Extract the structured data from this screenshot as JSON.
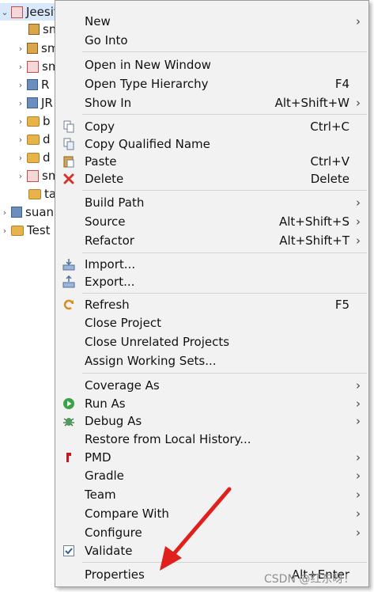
{
  "tree": {
    "items": [
      {
        "name": "Jeesite",
        "expanded": true,
        "selected": true,
        "icon": "project-icon"
      },
      {
        "name": "sm",
        "icon": "package-icon"
      },
      {
        "name": "sm",
        "icon": "package-icon"
      },
      {
        "name": "sm",
        "icon": "package-icon"
      },
      {
        "name": "R",
        "icon": "library-icon"
      },
      {
        "name": "JR",
        "icon": "library-icon"
      },
      {
        "name": "b",
        "icon": "folder-icon"
      },
      {
        "name": "d",
        "icon": "folder-icon"
      },
      {
        "name": "d",
        "icon": "folder-icon"
      },
      {
        "name": "sm",
        "icon": "package-icon"
      },
      {
        "name": "ta",
        "icon": "folder-icon"
      },
      {
        "name": "suan",
        "icon": "project-icon"
      },
      {
        "name": "Test",
        "icon": "project-icon"
      }
    ]
  },
  "menu": {
    "items": [
      {
        "label": "New",
        "submenu": true
      },
      {
        "label": "Go Into"
      },
      {
        "label": "Open in New Window"
      },
      {
        "label": "Open Type Hierarchy",
        "accel": "F4"
      },
      {
        "label": "Show In",
        "accel": "Alt+Shift+W",
        "submenu": true
      },
      {
        "label": "Copy",
        "accel": "Ctrl+C",
        "icon": "copy-icon"
      },
      {
        "label": "Copy Qualified Name",
        "icon": "copy-qualified-name-icon"
      },
      {
        "label": "Paste",
        "accel": "Ctrl+V",
        "icon": "paste-icon"
      },
      {
        "label": "Delete",
        "accel": "Delete",
        "icon": "delete-icon"
      },
      {
        "label": "Build Path",
        "submenu": true
      },
      {
        "label": "Source",
        "accel": "Alt+Shift+S",
        "submenu": true
      },
      {
        "label": "Refactor",
        "accel": "Alt+Shift+T",
        "submenu": true
      },
      {
        "label": "Import...",
        "icon": "import-icon"
      },
      {
        "label": "Export...",
        "icon": "export-icon"
      },
      {
        "label": "Refresh",
        "accel": "F5",
        "icon": "refresh-icon"
      },
      {
        "label": "Close Project"
      },
      {
        "label": "Close Unrelated Projects"
      },
      {
        "label": "Assign Working Sets..."
      },
      {
        "label": "Coverage As",
        "submenu": true
      },
      {
        "label": "Run As",
        "submenu": true,
        "icon": "run-icon"
      },
      {
        "label": "Debug As",
        "submenu": true,
        "icon": "debug-icon"
      },
      {
        "label": "Restore from Local History..."
      },
      {
        "label": "PMD",
        "submenu": true,
        "icon": "pmd-icon"
      },
      {
        "label": "Gradle",
        "submenu": true
      },
      {
        "label": "Team",
        "submenu": true
      },
      {
        "label": "Compare With",
        "submenu": true
      },
      {
        "label": "Configure",
        "submenu": true
      },
      {
        "label": "Validate",
        "icon": "validate-icon"
      },
      {
        "label": "Properties",
        "accel": "Alt+Enter"
      }
    ],
    "submenu_arrow": "›"
  },
  "watermark": "CSDN @红东呀！",
  "colors": {
    "menu_bg": "#f2f2f2",
    "selection": "#d9e8fb",
    "annotation_arrow": "#e0201c"
  }
}
